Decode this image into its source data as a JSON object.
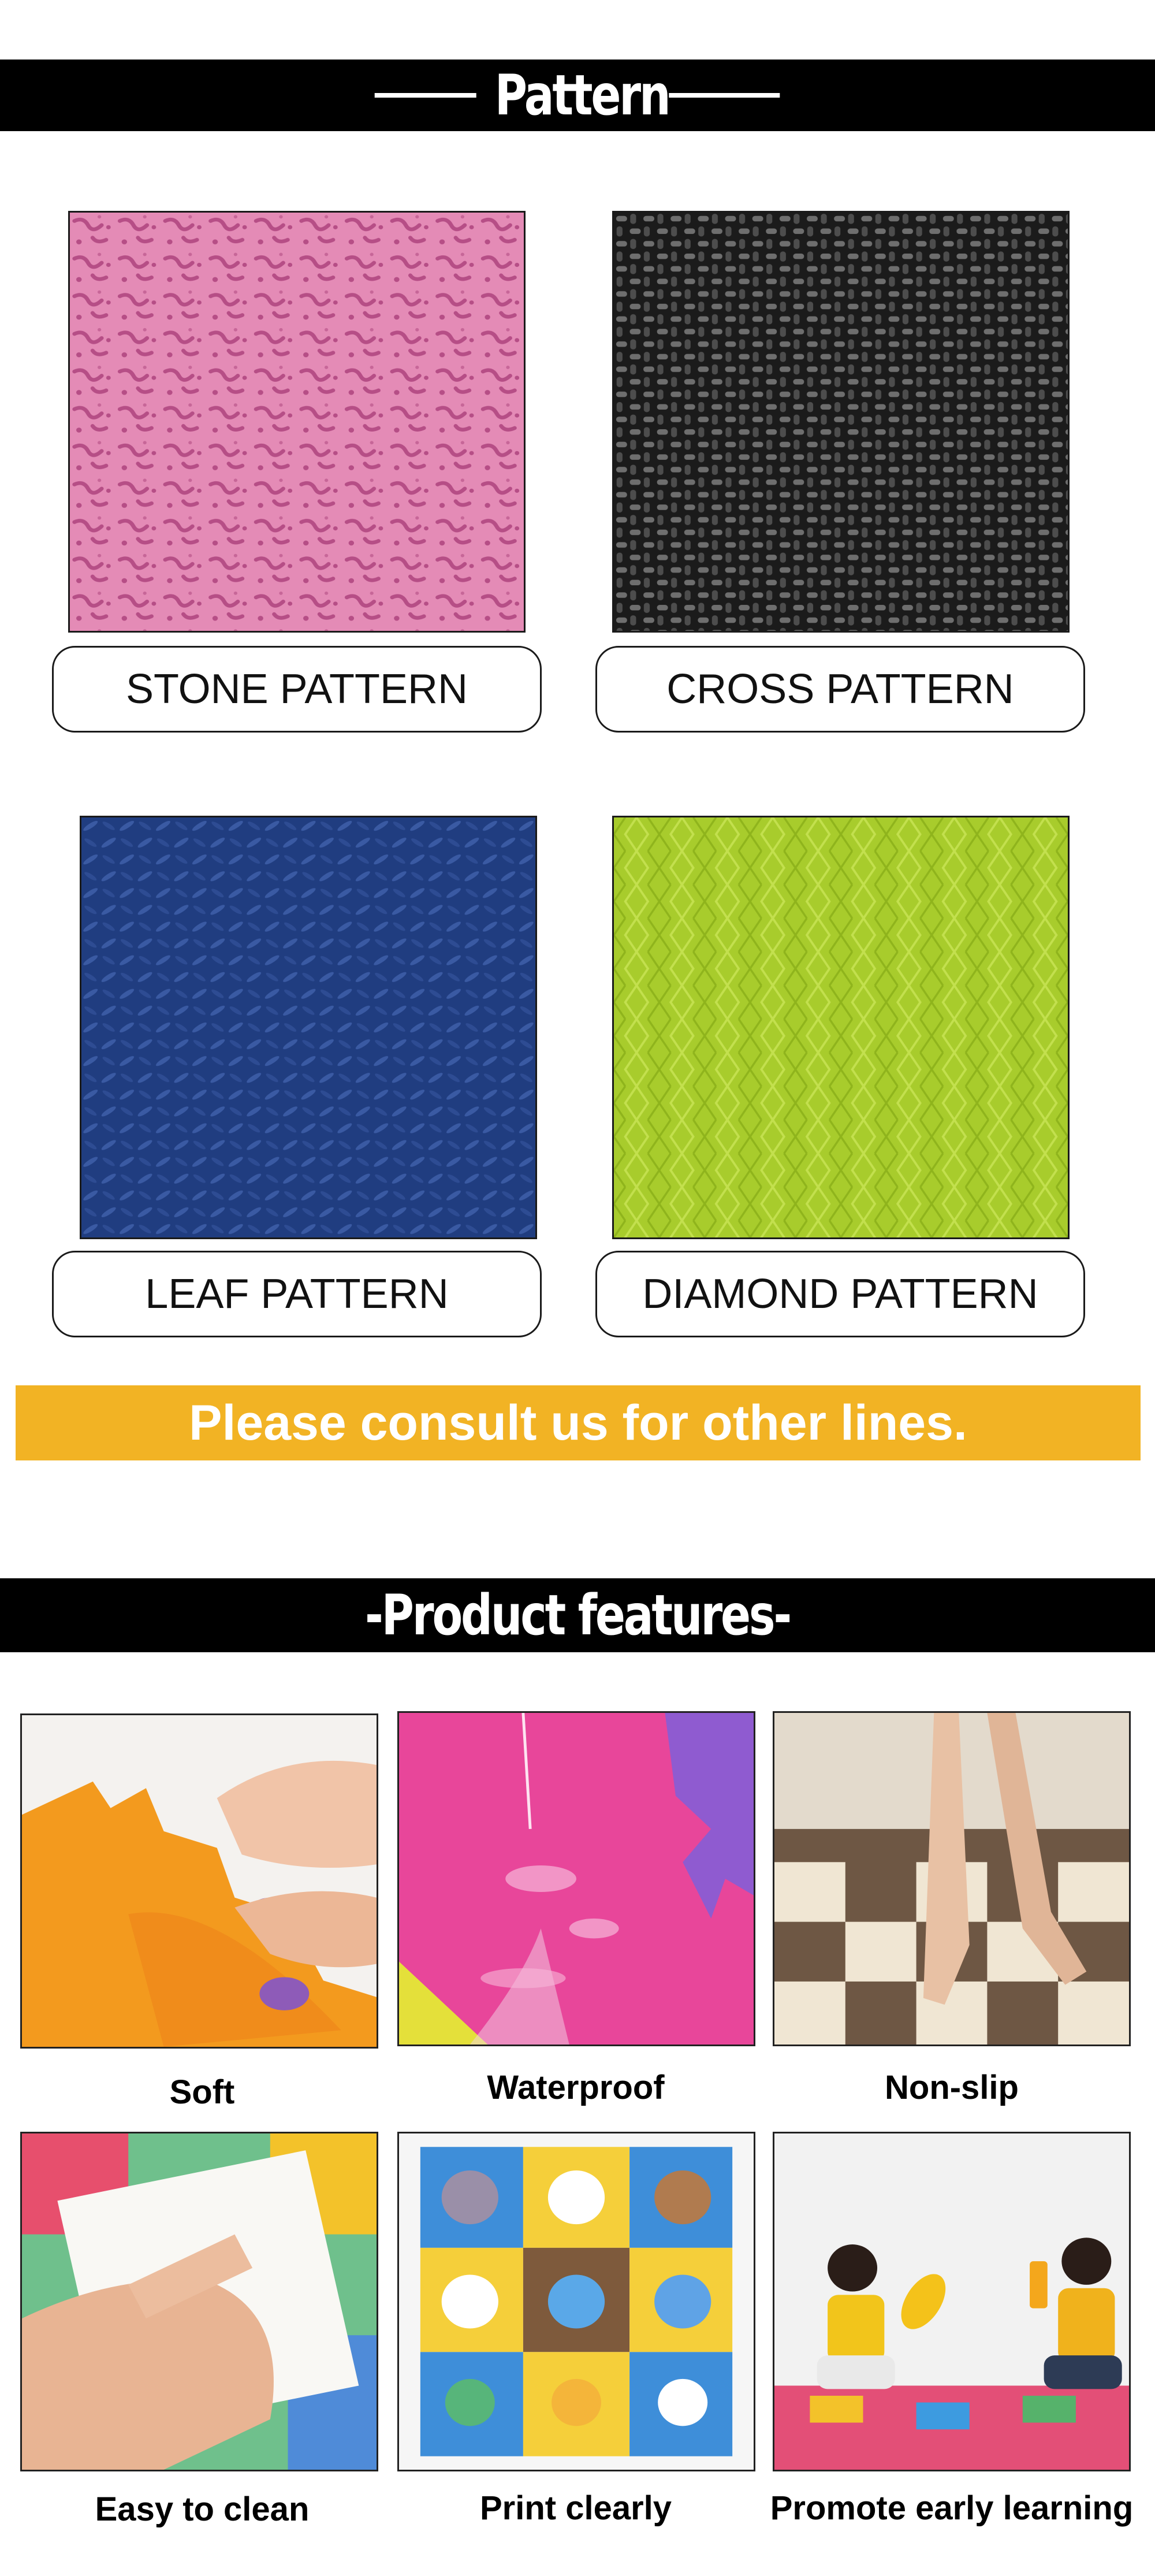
{
  "pattern_section": {
    "title": "Pattern",
    "items": [
      {
        "label": "STONE PATTERN"
      },
      {
        "label": "CROSS PATTERN"
      },
      {
        "label": "LEAF PATTERN"
      },
      {
        "label": "DIAMOND PATTERN"
      }
    ],
    "consult_text": "Please consult us for other lines."
  },
  "features_section": {
    "title": "-Product features-",
    "items": [
      {
        "label": "Soft"
      },
      {
        "label": "Waterproof"
      },
      {
        "label": "Non-slip"
      },
      {
        "label": "Easy to clean"
      },
      {
        "label": "Print clearly"
      },
      {
        "label": "Promote early learning"
      }
    ]
  },
  "colors": {
    "banner": "#000000",
    "consult_bar": "#f2b324",
    "stone_pink": "#e27fb0",
    "cross_black": "#1e1e1e",
    "leaf_blue": "#1f3a7a",
    "diamond_green": "#a9cc2a"
  }
}
